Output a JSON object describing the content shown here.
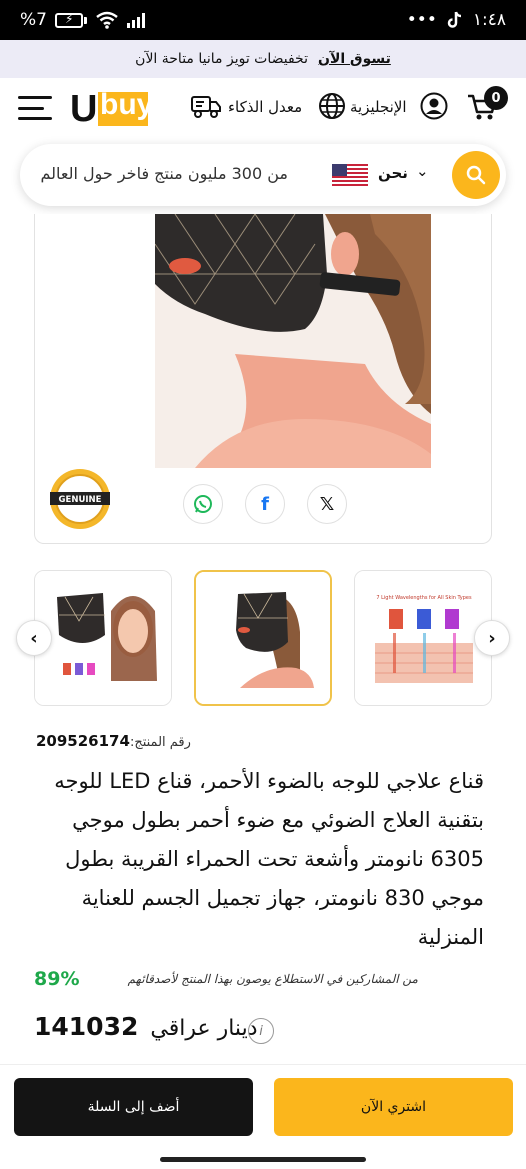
{
  "status_bar": {
    "battery_level": "7",
    "time": "١:٤٨",
    "dots": "•••"
  },
  "promo": {
    "shop_now": "تسوق الآن",
    "text": "تخفيضات تويز مانيا متاحة الآن"
  },
  "header": {
    "logo_u": "U",
    "logo_buy": "buy",
    "smart_rate": "معدل الذكاء",
    "language": "الإنجليزية",
    "cart_count": "0"
  },
  "search": {
    "placeholder": "من 300 مليون منتج فاخر حول العالم",
    "ship_to": "نحن",
    "chevron": "⌄"
  },
  "badge": {
    "genuine": "GENUINE"
  },
  "share": {
    "x": "𝕏",
    "facebook": "f"
  },
  "product": {
    "id_label": "رقم المنتج:",
    "id_value": "209526174",
    "title": "قناع علاجي للوجه بالضوء الأحمر، قناع LED للوجه بتقنية العلاج الضوئي مع ضوء أحمر بطول موجي 6305 نانومتر وأشعة تحت الحمراء القريبة بطول موجي 830 نانومتر، جهاز تجميل الجسم للعناية المنزلية",
    "recommend_percent": "89%",
    "recommend_text": "من المشاركين في الاستطلاع يوصون بهذا المنتج لأصدقائهم",
    "price": "141032",
    "currency": "دينار عراقي",
    "info": "i"
  },
  "thumbnails": {
    "prev": "‹",
    "next": "›",
    "caption_3": "7 Light Wavelengths for All Skin Types"
  },
  "actions": {
    "add_to_cart": "أضف إلى السلة",
    "buy_now": "اشتري الآن"
  },
  "colors": {
    "accent": "#fbb61c",
    "promo_bg": "#ecebf6",
    "recommend_green": "#1ea84a",
    "dark_button": "#141414"
  }
}
